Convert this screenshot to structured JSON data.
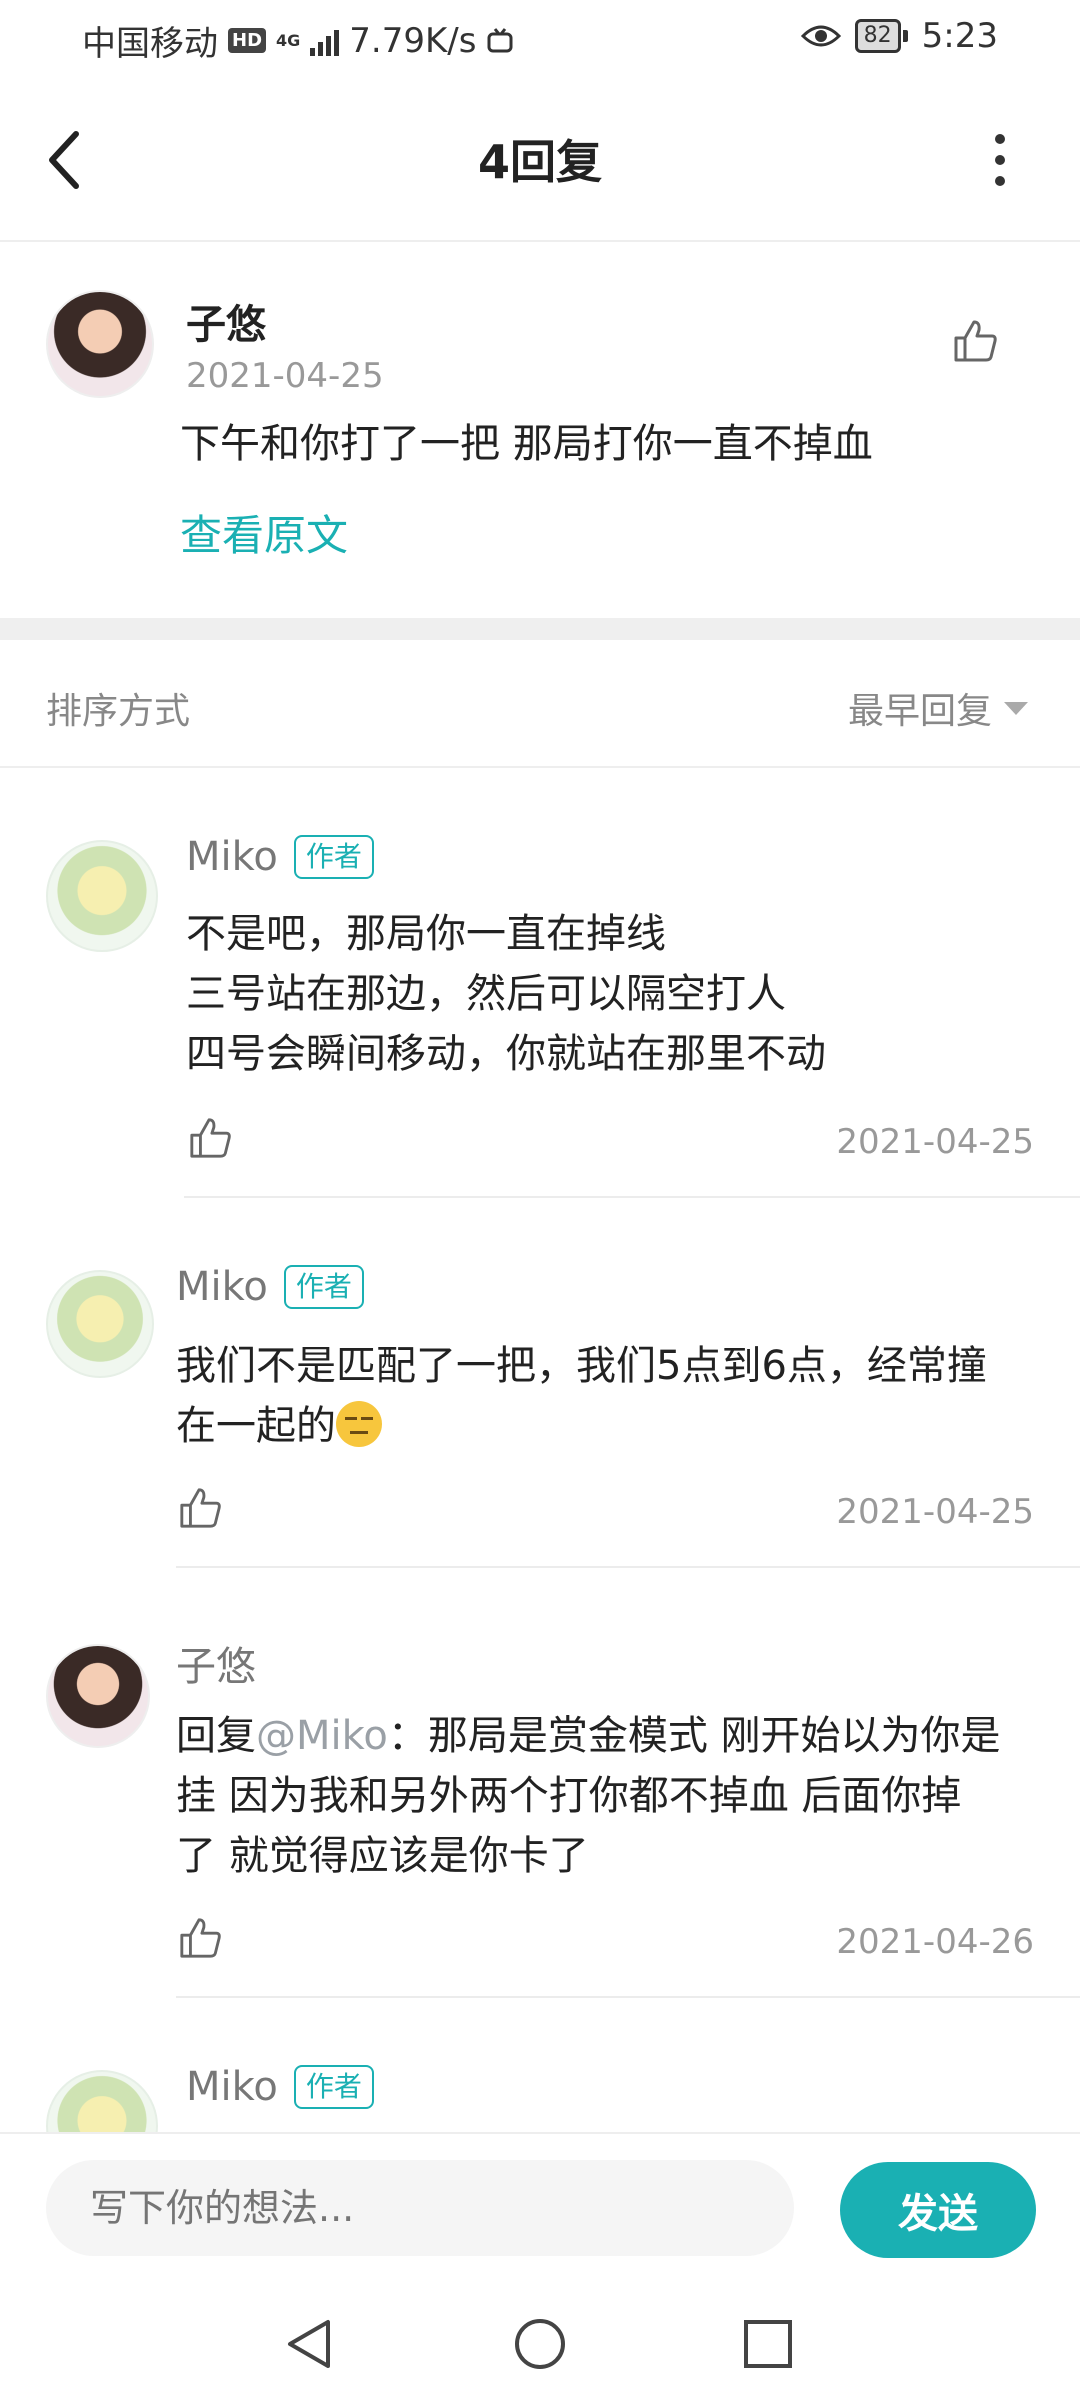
{
  "status_bar": {
    "carrier": "中国移动",
    "hd": "HD",
    "network": "4G",
    "speed": "7.79K/s",
    "battery": "82",
    "time": "5:23"
  },
  "header": {
    "title": "4回复"
  },
  "original": {
    "user": "子悠",
    "date": "2021-04-25",
    "text": "下午和你打了一把 那局打你一直不掉血",
    "view_original": "查看原文"
  },
  "sort": {
    "label": "排序方式",
    "selected": "最早回复"
  },
  "replies": [
    {
      "user": "Miko",
      "badge": "作者",
      "lines": [
        "不是吧，那局你一直在掉线",
        "三号站在那边，然后可以隔空打人",
        "四号会瞬间移动，你就站在那里不动"
      ],
      "date": "2021-04-25"
    },
    {
      "user": "Miko",
      "badge": "作者",
      "lines": [
        "我们不是匹配了一把，我们5点到6点，经常撞",
        "在一起的"
      ],
      "emoji": "expressionless-face",
      "date": "2021-04-25"
    },
    {
      "user": "子悠",
      "reply_prefix": "回复",
      "mention": "@Miko",
      "reply_colon": "：",
      "lines": [
        "那局是赏金模式 刚开始以为你是",
        "挂 因为我和另外两个打你都不掉血 后面你掉",
        "了 就觉得应该是你卡了"
      ],
      "date": "2021-04-26"
    },
    {
      "user": "Miko",
      "badge": "作者"
    }
  ],
  "composer": {
    "placeholder": "写下你的想法...",
    "send": "发送"
  },
  "colors": {
    "accent": "#1ab0b3",
    "badge_border": "#1ab0b3",
    "divider": "#efefef"
  }
}
